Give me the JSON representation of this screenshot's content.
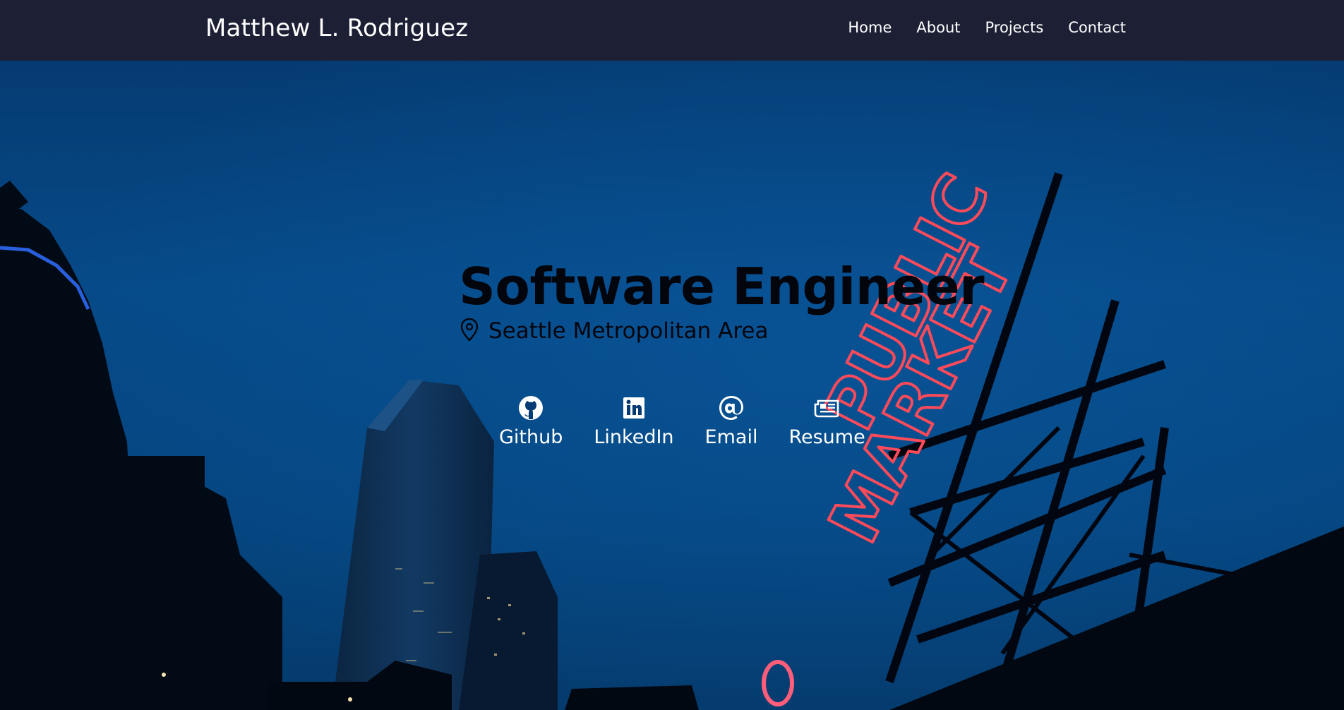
{
  "header": {
    "brand": "Matthew L. Rodriguez",
    "nav": [
      {
        "label": "Home"
      },
      {
        "label": "About"
      },
      {
        "label": "Projects"
      },
      {
        "label": "Contact"
      }
    ]
  },
  "hero": {
    "title": "Software Engineer",
    "location": {
      "icon": "map-pin-icon",
      "text": "Seattle Metropolitan Area"
    },
    "background": {
      "sign_text": "PUBLIC MARKET",
      "sign_color": "#ff4a5a",
      "sky_color": "#05457f"
    },
    "links": [
      {
        "label": "Github",
        "icon": "github-icon"
      },
      {
        "label": "LinkedIn",
        "icon": "linkedin-icon"
      },
      {
        "label": "Email",
        "icon": "at-sign-icon"
      },
      {
        "label": "Resume",
        "icon": "newspaper-icon"
      }
    ]
  },
  "colors": {
    "navbar_bg": "#1d2035",
    "nav_text": "#ffffff",
    "headline_text": "#02050c"
  }
}
